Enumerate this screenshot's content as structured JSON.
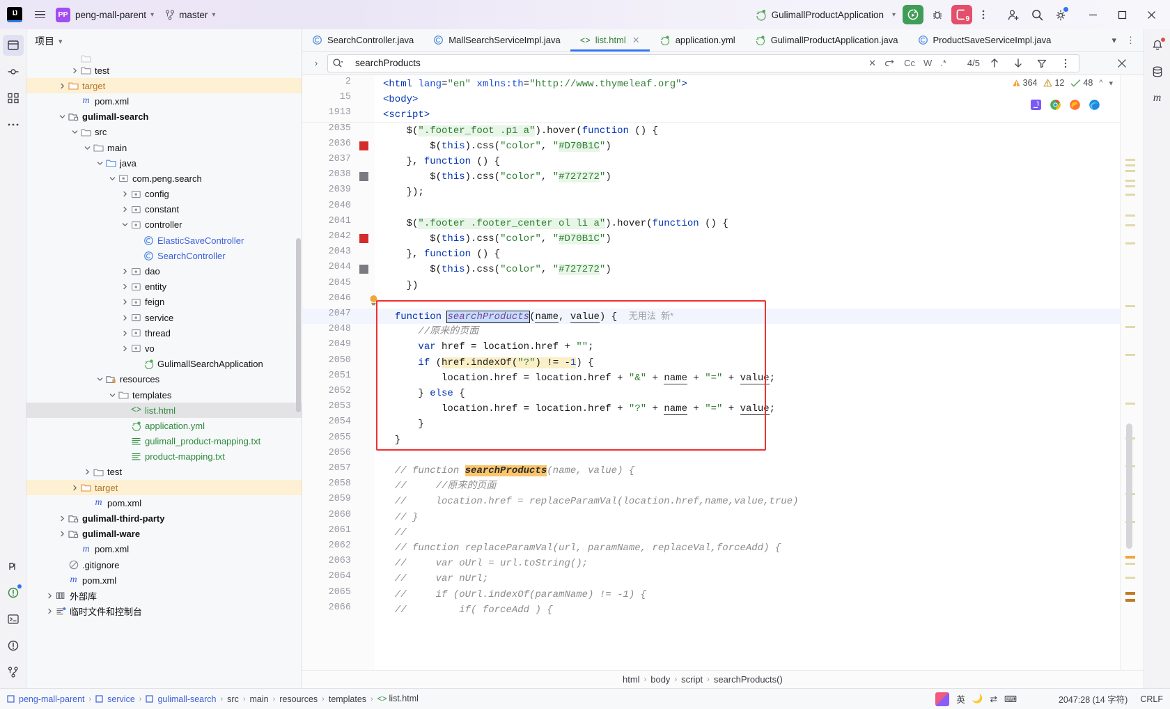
{
  "titlebar": {
    "ide_logo": "IJ",
    "menu_icon": "hamburger-menu-icon",
    "project_badge": "PP",
    "project_name": "peng-mall-parent",
    "branch_icon": "git-branch-icon",
    "branch_name": "master",
    "run_config_name": "GulimallProductApplication",
    "run_button": "run-icon",
    "debug_button": "debug-icon",
    "stop_button": "stop-icon",
    "stop_badge": "9",
    "more_button": "more-vertical-icon",
    "account_icon": "add-user-icon",
    "search_icon": "search-icon",
    "settings_icon": "gear-icon",
    "minimize": "minimize-icon",
    "maximize": "maximize-icon",
    "close": "close-icon"
  },
  "left_strip": {
    "items": [
      {
        "name": "project-tool-icon",
        "active": true
      },
      {
        "name": "commit-tool-icon",
        "active": false
      },
      {
        "name": "structure-tool-icon",
        "active": false
      },
      {
        "name": "more-tools-icon",
        "active": false
      }
    ],
    "bottom_items": [
      {
        "name": "ai-assistant-icon"
      },
      {
        "name": "database-tool-icon"
      },
      {
        "name": "terminal-tool-icon"
      },
      {
        "name": "problems-tool-icon"
      },
      {
        "name": "git-tool-icon"
      }
    ]
  },
  "project_panel": {
    "title": "项目",
    "chevron": "chevron-down-icon",
    "tree": [
      {
        "indent": 3,
        "arrow": "",
        "icon": "folder",
        "label": "",
        "cls": "",
        "partial": true
      },
      {
        "indent": 3,
        "arrow": "right",
        "icon": "folder",
        "label": "test",
        "cls": ""
      },
      {
        "indent": 2,
        "arrow": "right",
        "icon": "folder-orange",
        "label": "target",
        "cls": "orange",
        "hl": true
      },
      {
        "indent": 3,
        "arrow": "",
        "icon": "maven",
        "label": "pom.xml",
        "cls": ""
      },
      {
        "indent": 2,
        "arrow": "down",
        "icon": "module",
        "label": "gulimall-search",
        "cls": "bold"
      },
      {
        "indent": 3,
        "arrow": "down",
        "icon": "folder",
        "label": "src",
        "cls": ""
      },
      {
        "indent": 4,
        "arrow": "down",
        "icon": "folder",
        "label": "main",
        "cls": ""
      },
      {
        "indent": 5,
        "arrow": "down",
        "icon": "folder-blue",
        "label": "java",
        "cls": ""
      },
      {
        "indent": 6,
        "arrow": "down",
        "icon": "package",
        "label": "com.peng.search",
        "cls": ""
      },
      {
        "indent": 7,
        "arrow": "right",
        "icon": "package",
        "label": "config",
        "cls": ""
      },
      {
        "indent": 7,
        "arrow": "right",
        "icon": "package",
        "label": "constant",
        "cls": ""
      },
      {
        "indent": 7,
        "arrow": "down",
        "icon": "package",
        "label": "controller",
        "cls": ""
      },
      {
        "indent": 8,
        "arrow": "",
        "icon": "class",
        "label": "ElasticSaveController",
        "cls": "blue"
      },
      {
        "indent": 8,
        "arrow": "",
        "icon": "class",
        "label": "SearchController",
        "cls": "blue"
      },
      {
        "indent": 7,
        "arrow": "right",
        "icon": "package",
        "label": "dao",
        "cls": ""
      },
      {
        "indent": 7,
        "arrow": "right",
        "icon": "package",
        "label": "entity",
        "cls": ""
      },
      {
        "indent": 7,
        "arrow": "right",
        "icon": "package",
        "label": "feign",
        "cls": ""
      },
      {
        "indent": 7,
        "arrow": "right",
        "icon": "package",
        "label": "service",
        "cls": ""
      },
      {
        "indent": 7,
        "arrow": "right",
        "icon": "package",
        "label": "thread",
        "cls": ""
      },
      {
        "indent": 7,
        "arrow": "right",
        "icon": "package",
        "label": "vo",
        "cls": ""
      },
      {
        "indent": 8,
        "arrow": "",
        "icon": "springboot",
        "label": "GulimallSearchApplication",
        "cls": ""
      },
      {
        "indent": 5,
        "arrow": "down",
        "icon": "resources",
        "label": "resources",
        "cls": ""
      },
      {
        "indent": 6,
        "arrow": "down",
        "icon": "folder",
        "label": "templates",
        "cls": ""
      },
      {
        "indent": 7,
        "arrow": "",
        "icon": "html",
        "label": "list.html",
        "cls": "green",
        "sel": true
      },
      {
        "indent": 7,
        "arrow": "",
        "icon": "yml",
        "label": "application.yml",
        "cls": "green"
      },
      {
        "indent": 7,
        "arrow": "",
        "icon": "txt",
        "label": "gulimall_product-mapping.txt",
        "cls": "green"
      },
      {
        "indent": 7,
        "arrow": "",
        "icon": "txt",
        "label": "product-mapping.txt",
        "cls": "green"
      },
      {
        "indent": 4,
        "arrow": "right",
        "icon": "folder",
        "label": "test",
        "cls": ""
      },
      {
        "indent": 3,
        "arrow": "right",
        "icon": "folder-orange",
        "label": "target",
        "cls": "orange",
        "hl": true
      },
      {
        "indent": 4,
        "arrow": "",
        "icon": "maven",
        "label": "pom.xml",
        "cls": ""
      },
      {
        "indent": 2,
        "arrow": "right",
        "icon": "module",
        "label": "gulimall-third-party",
        "cls": "bold"
      },
      {
        "indent": 2,
        "arrow": "right",
        "icon": "module",
        "label": "gulimall-ware",
        "cls": "bold"
      },
      {
        "indent": 3,
        "arrow": "",
        "icon": "maven",
        "label": "pom.xml",
        "cls": ""
      },
      {
        "indent": 2,
        "arrow": "",
        "icon": "gitignore",
        "label": ".gitignore",
        "cls": ""
      },
      {
        "indent": 2,
        "arrow": "",
        "icon": "maven",
        "label": "pom.xml",
        "cls": ""
      },
      {
        "indent": 1,
        "arrow": "right",
        "icon": "library",
        "label": "外部库",
        "cls": ""
      },
      {
        "indent": 1,
        "arrow": "right",
        "icon": "scratch",
        "label": "临时文件和控制台",
        "cls": ""
      }
    ]
  },
  "editor_tabs": [
    {
      "label": "SearchController.java",
      "icon": "java-class-icon",
      "active": false,
      "closable": false
    },
    {
      "label": "MallSearchServiceImpl.java",
      "icon": "java-class-icon",
      "active": false,
      "closable": false
    },
    {
      "label": "list.html",
      "icon": "html-file-icon",
      "active": true,
      "closable": true
    },
    {
      "label": "application.yml",
      "icon": "springboot-yml-icon",
      "active": false,
      "closable": false
    },
    {
      "label": "GulimallProductApplication.java",
      "icon": "springboot-class-icon",
      "active": false,
      "closable": false
    },
    {
      "label": "ProductSaveServiceImpl.java",
      "icon": "java-class-icon",
      "active": false,
      "closable": false
    }
  ],
  "tabs_right": {
    "chevron_icon": "chevron-down-icon",
    "more_icon": "more-vertical-icon"
  },
  "findbar": {
    "expand_icon": "chevron-right-icon",
    "search_icon": "search-dropdown-icon",
    "query": "searchProducts",
    "clear_icon": "close-icon",
    "history_icon": "history-icon",
    "match_case": "Cc",
    "words": "W",
    "regex": ".*",
    "match_count": "4/5",
    "prev_icon": "arrow-up-icon",
    "next_icon": "arrow-down-icon",
    "filter_icon": "filter-icon",
    "options_icon": "more-vertical-icon",
    "close_icon": "close-icon"
  },
  "inspections": {
    "warnings": "364",
    "weak_warnings": "12",
    "typos": "48",
    "warning_icon": "warning-triangle-icon",
    "weak_icon": "weak-warning-icon",
    "typo_icon": "typo-check-icon",
    "up_icon": "chevron-up-icon",
    "down_icon": "chevron-down-icon"
  },
  "browser_icons": [
    "jetbrains-browser-icon",
    "chrome-icon",
    "firefox-icon",
    "edge-icon"
  ],
  "code": {
    "collapsed_lines": [
      {
        "num": "2",
        "html": "<span class=\"tag\">&lt;html</span> <span class=\"attr\">lang</span>=<span class=\"s\">\"en\"</span> <span class=\"attr\">xmlns:th</span>=<span class=\"s\">\"http://www.thymeleaf.org\"</span><span class=\"tag\">&gt;</span>",
        "indent": 0
      },
      {
        "num": "15",
        "html": "<span class=\"tag\">&lt;body&gt;</span>",
        "indent": 0
      },
      {
        "num": "1913",
        "html": "<span class=\"tag\">&lt;script&gt;</span>",
        "indent": 0
      }
    ],
    "lines": [
      {
        "num": "2035",
        "marker": "",
        "html": "    $(<span class=\"s hlgreen\">\".footer_foot .p1 a\"</span>).<span class=\"pl\">hover</span>(<span class=\"k\">function</span> () {"
      },
      {
        "num": "2036",
        "marker": "red",
        "html": "        $(<span class=\"k\">this</span>).<span class=\"pl\">css</span>(<span class=\"s\">\"color\"</span>, <span class=\"s\">\"<span class=\"hlgreen\">#D70B1C</span>\"</span>)"
      },
      {
        "num": "2037",
        "marker": "",
        "html": "    }, <span class=\"k\">function</span> () {"
      },
      {
        "num": "2038",
        "marker": "gray",
        "html": "        $(<span class=\"k\">this</span>).<span class=\"pl\">css</span>(<span class=\"s\">\"color\"</span>, <span class=\"s\">\"<span class=\"hlgreen\">#727272</span>\"</span>)"
      },
      {
        "num": "2039",
        "marker": "",
        "html": "    });"
      },
      {
        "num": "2040",
        "marker": "",
        "html": ""
      },
      {
        "num": "2041",
        "marker": "",
        "html": "    $(<span class=\"s hlgreen\">\".footer .footer_center ol li a\"</span>).<span class=\"pl\">hover</span>(<span class=\"k\">function</span> () {"
      },
      {
        "num": "2042",
        "marker": "red",
        "html": "        $(<span class=\"k\">this</span>).<span class=\"pl\">css</span>(<span class=\"s\">\"color\"</span>, <span class=\"s\">\"<span class=\"hlgreen\">#D70B1C</span>\"</span>)"
      },
      {
        "num": "2043",
        "marker": "",
        "html": "    }, <span class=\"k\">function</span> () {"
      },
      {
        "num": "2044",
        "marker": "gray",
        "html": "        $(<span class=\"k\">this</span>).<span class=\"pl\">css</span>(<span class=\"s\">\"color\"</span>, <span class=\"s\">\"<span class=\"hlgreen\">#727272</span>\"</span>)"
      },
      {
        "num": "2045",
        "marker": "",
        "html": "    })"
      },
      {
        "num": "2046",
        "marker": "bulb",
        "html": ""
      },
      {
        "num": "2047",
        "marker": "",
        "hlrow": true,
        "html": "  <span class=\"k\">function</span> <span class=\"fn selbox\" style=\"font-style:italic\">searchProducts</span>(<span class=\"und\">name</span>, <span class=\"und\">value</span>) {  <span class=\"gray-hint\">无用法  新*</span>"
      },
      {
        "num": "2048",
        "marker": "",
        "html": "      <span class=\"cm\">//原来的页面</span>"
      },
      {
        "num": "2049",
        "marker": "",
        "html": "      <span class=\"k\">var</span> <span class=\"pl\">href</span> = <span class=\"pl\">location</span>.<span class=\"pl\">href</span> + <span class=\"s\">\"\"</span>;"
      },
      {
        "num": "2050",
        "marker": "",
        "html": "      <span class=\"k\">if</span> (<span class=\"hlyellow\"><span class=\"pl\">href</span>.<span class=\"pl\">indexOf</span>(<span class=\"s\">\"?\"</span>) != -<span class=\"n\">1</span></span>) {"
      },
      {
        "num": "2051",
        "marker": "",
        "html": "          <span class=\"pl\">location</span>.<span class=\"pl\">href</span> = <span class=\"pl\">location</span>.<span class=\"pl\">href</span> + <span class=\"s\">\"&amp;\"</span> + <span class=\"und\">name</span> + <span class=\"s\">\"=\"</span> + <span class=\"und\">value</span>;"
      },
      {
        "num": "2052",
        "marker": "",
        "html": "      } <span class=\"k\">else</span> {"
      },
      {
        "num": "2053",
        "marker": "",
        "html": "          <span class=\"pl\">location</span>.<span class=\"pl\">href</span> = <span class=\"pl\">location</span>.<span class=\"pl\">href</span> + <span class=\"s\">\"?\"</span> + <span class=\"und\">name</span> + <span class=\"s\">\"=\"</span> + <span class=\"und\">value</span>;"
      },
      {
        "num": "2054",
        "marker": "",
        "html": "      }"
      },
      {
        "num": "2055",
        "marker": "",
        "html": "  }"
      },
      {
        "num": "2056",
        "marker": "",
        "html": ""
      },
      {
        "num": "2057",
        "marker": "",
        "html": "  <span class=\"cm\">// function </span><span class=\"cm hlorange\" style=\"font-weight:bold;color:#2b2b2b\">searchProducts</span><span class=\"cm\">(name, value) {</span>"
      },
      {
        "num": "2058",
        "marker": "",
        "html": "  <span class=\"cm\">//     //原来的页面</span>"
      },
      {
        "num": "2059",
        "marker": "",
        "html": "  <span class=\"cm\">//     location.href = replaceParamVal(location.href,name,value,true)</span>"
      },
      {
        "num": "2060",
        "marker": "",
        "html": "  <span class=\"cm\">// }</span>"
      },
      {
        "num": "2061",
        "marker": "",
        "html": "  <span class=\"cm\">//</span>"
      },
      {
        "num": "2062",
        "marker": "",
        "html": "  <span class=\"cm\">// function replaceParamVal(url, paramName, replaceVal,forceAdd) {</span>"
      },
      {
        "num": "2063",
        "marker": "",
        "html": "  <span class=\"cm\">//     var oUrl = url.toString();</span>"
      },
      {
        "num": "2064",
        "marker": "",
        "html": "  <span class=\"cm\">//     var nUrl;</span>"
      },
      {
        "num": "2065",
        "marker": "",
        "html": "  <span class=\"cm\">//     if (oUrl.indexOf(paramName) != -1) {</span>"
      },
      {
        "num": "2066",
        "marker": "",
        "html": "  <span class=\"cm\">//         if( forceAdd ) {</span>"
      }
    ]
  },
  "breadcrumb_editor": [
    "html",
    "body",
    "script",
    "searchProducts()"
  ],
  "statusbar": {
    "path": [
      {
        "label": "peng-mall-parent",
        "icon": "module-icon",
        "link": true
      },
      {
        "label": "service",
        "icon": "module-icon",
        "link": true
      },
      {
        "label": "gulimall-search",
        "icon": "module-icon",
        "link": true
      },
      {
        "label": "src",
        "icon": "",
        "link": false
      },
      {
        "label": "main",
        "icon": "",
        "link": false
      },
      {
        "label": "resources",
        "icon": "",
        "link": false
      },
      {
        "label": "templates",
        "icon": "",
        "link": false
      },
      {
        "label": "list.html",
        "icon": "html-file-icon",
        "link": false
      }
    ],
    "caret": "2047:28 (14 字符)",
    "line_sep": "CRLF",
    "ime_label": "英",
    "ime_icons": [
      "ime-square-icon",
      "moon-icon",
      "sync-icon",
      "keyboard-icon"
    ]
  },
  "right_strip": {
    "items": [
      "notifications-icon",
      "database-icon",
      "maven-icon"
    ]
  },
  "colors": {
    "accent_blue": "#3574f0",
    "run_green": "#3f9d58",
    "stop_red": "#e3506b",
    "highlight_yellow": "#fdf0d3",
    "red_box": "#f03030",
    "string_green": "#2e7d32",
    "keyword_blue": "#0033b3"
  }
}
